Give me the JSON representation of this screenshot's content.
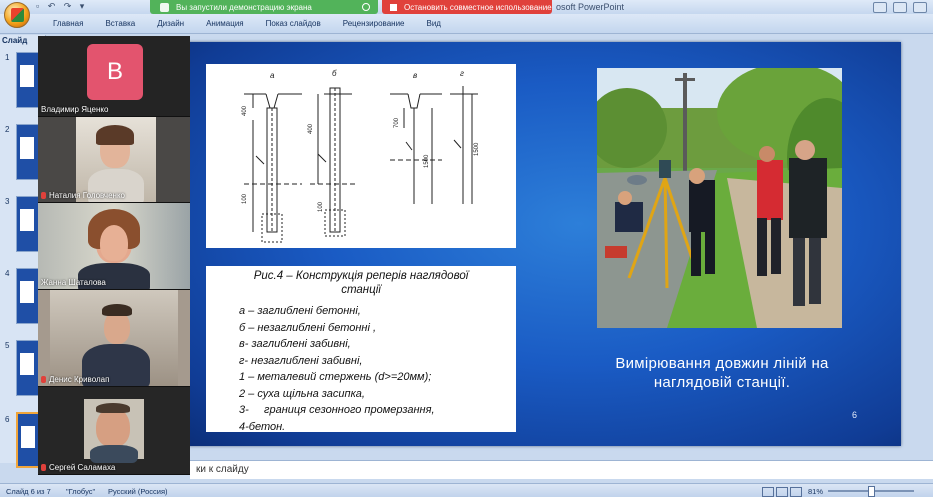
{
  "app": {
    "title": "osoft PowerPoint",
    "qat": "▫ ↶ ↷ ▾"
  },
  "share": {
    "status_text": "Вы запустили демонстрацию экрана",
    "stop_label": "Остановить совместное использование"
  },
  "ribbon": {
    "tabs": [
      "Главная",
      "Вставка",
      "Дизайн",
      "Анимация",
      "Показ слайдов",
      "Рецензирование",
      "Вид"
    ]
  },
  "slides_panel": {
    "tab_label": "Слайд",
    "numbers": [
      "1",
      "2",
      "3",
      "4",
      "5",
      "6"
    ]
  },
  "participants": [
    {
      "name": "Владимир Яценко",
      "initial": "В",
      "avatar_color": "#e3546e",
      "muted": false
    },
    {
      "name": "Наталия Головченко",
      "muted": true
    },
    {
      "name": "Жанна Шаталова",
      "muted": false
    },
    {
      "name": "Денис Криволап",
      "muted": true
    },
    {
      "name": "Сергей Саламаха",
      "muted": true
    }
  ],
  "slide": {
    "figure_labels": [
      "а",
      "б",
      "в",
      "г"
    ],
    "dims": [
      "400",
      "100",
      "400",
      "1500",
      "1500",
      "100",
      "700"
    ],
    "caption_title_1": "Рис.4 – Конструкція реперів наглядової",
    "caption_title_2": "станції",
    "caption_items": [
      "а – заглиблені бетонні,",
      "б – незаглиблені бетонні ,",
      "в- заглиблені забивні,",
      "г- незаглиблені забивні,",
      "1 – металевий стержень (d>=20мм);",
      "2 – суха щільна засипка,",
      "3-     границя сезонного промерзання,",
      "4-бетон."
    ],
    "photo_caption": "Вимірювання довжин ліній на наглядовій станції.",
    "number": "6"
  },
  "notes": {
    "placeholder": "ки к слайду"
  },
  "status": {
    "slide_of": "Слайд 6 из 7",
    "theme": "\"Глобус\"",
    "language": "Русский (Россия)",
    "zoom": "81%"
  },
  "colors": {
    "share_green": "#52b35a",
    "stop_red": "#e0413b",
    "slide_blue": "#1a5bc4"
  }
}
